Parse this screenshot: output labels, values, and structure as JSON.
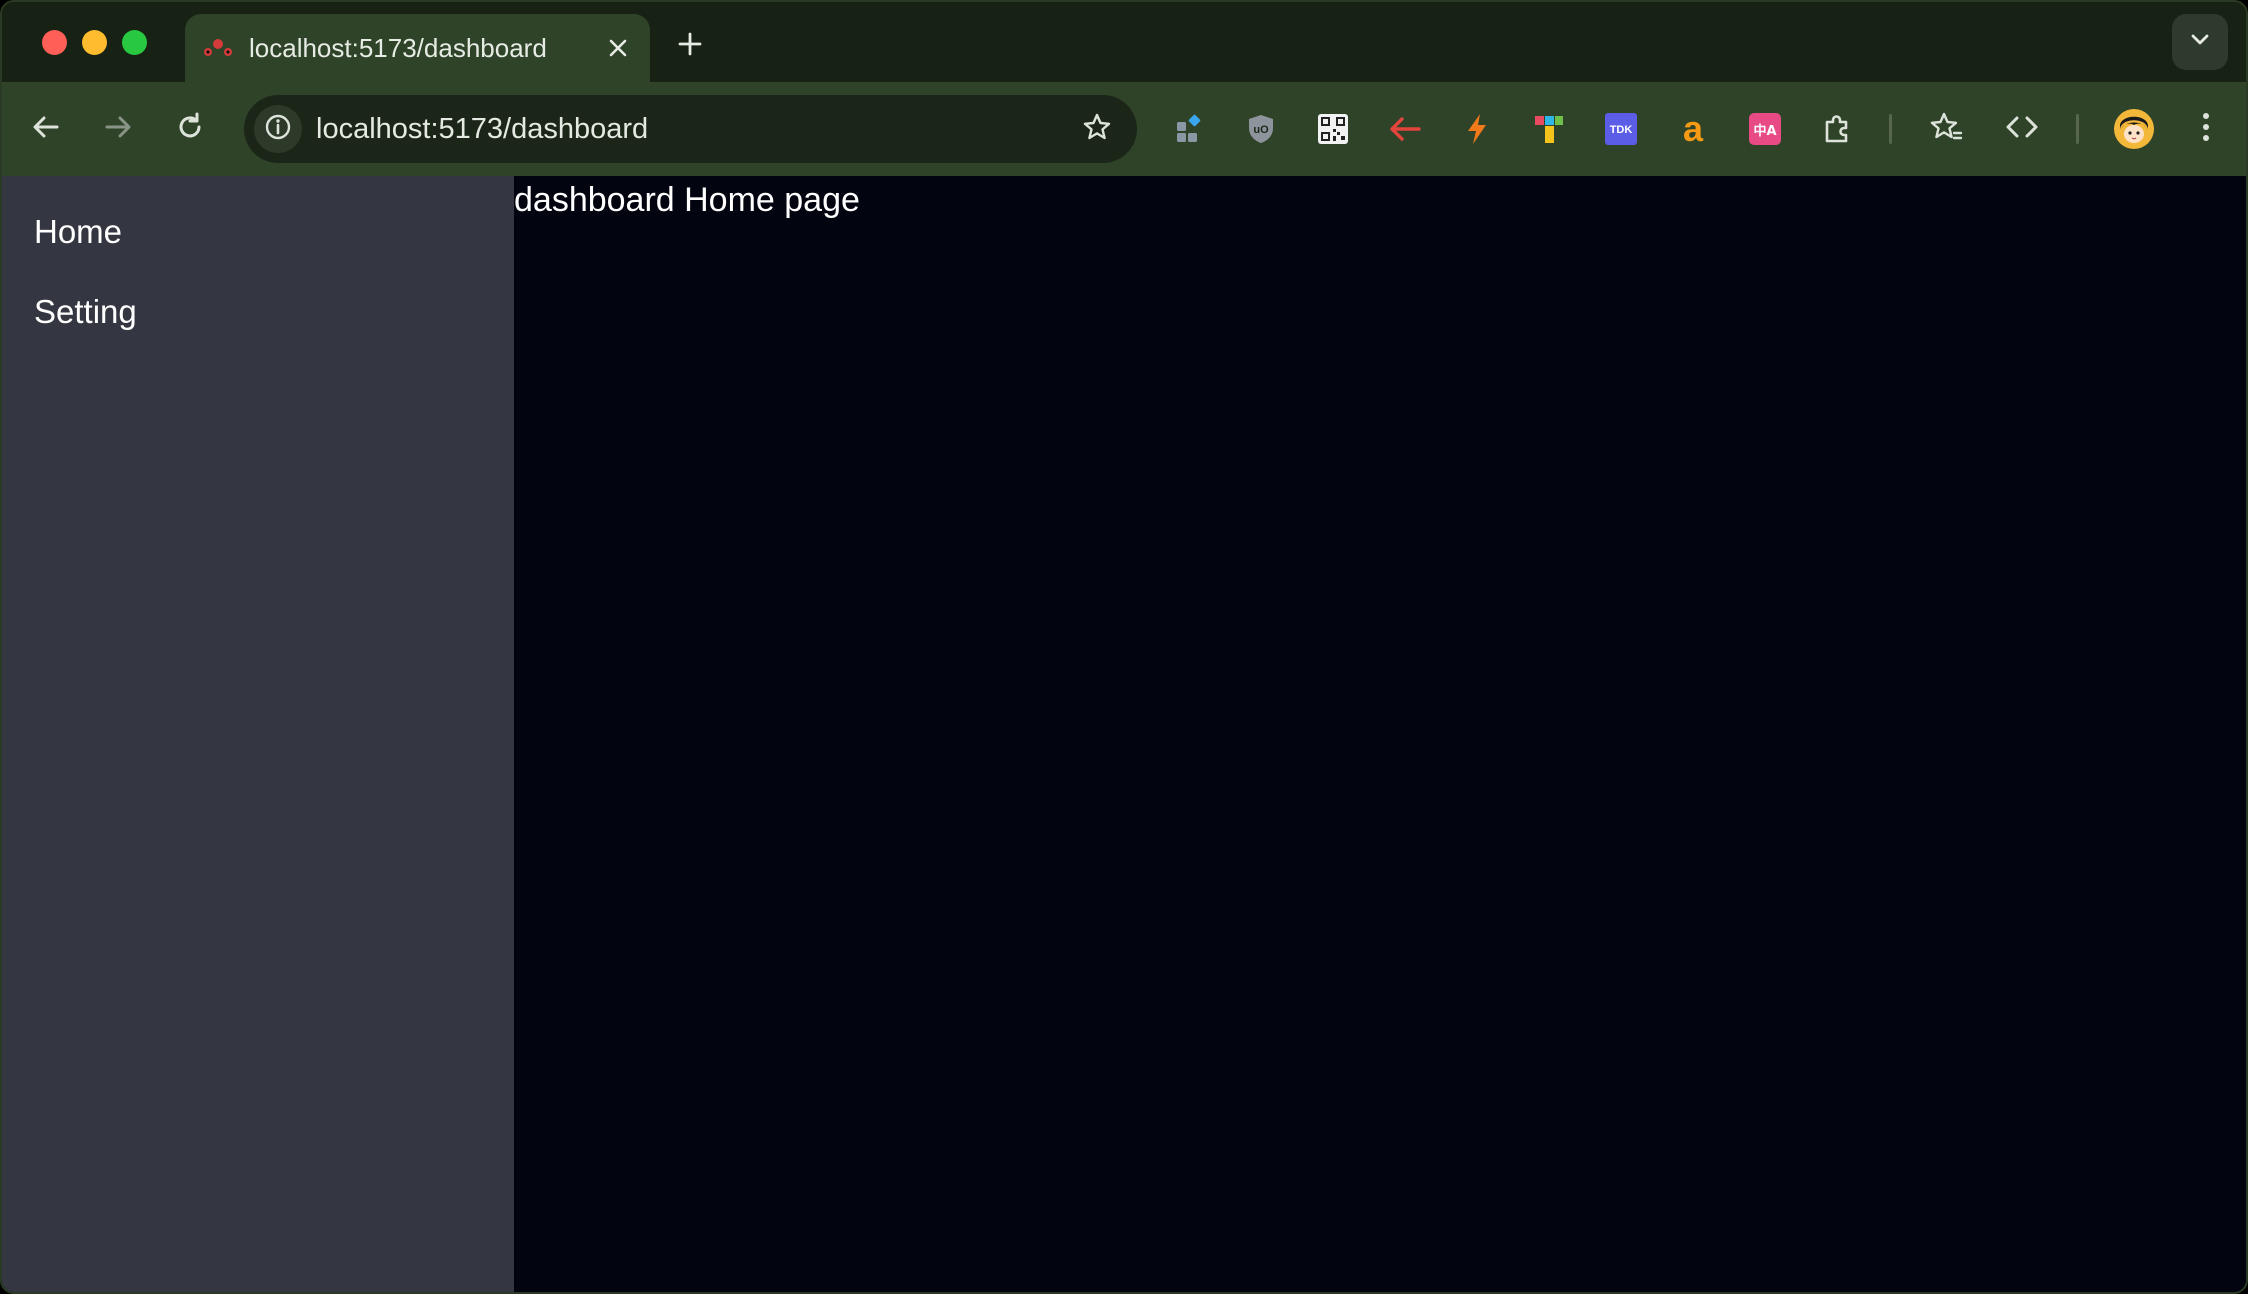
{
  "browser": {
    "tab": {
      "title": "localhost:5173/dashboard",
      "favicon": "react-router-icon"
    },
    "address_bar": {
      "url": "localhost:5173/dashboard"
    },
    "extensions": [
      {
        "name": "grid-app-icon"
      },
      {
        "name": "ublock-shield-icon",
        "label": "uO"
      },
      {
        "name": "qr-code-icon"
      },
      {
        "name": "red-arrow-left-icon"
      },
      {
        "name": "lightning-bolt-icon"
      },
      {
        "name": "color-tiles-icon"
      },
      {
        "name": "tdk-icon",
        "label": "TDK"
      },
      {
        "name": "letter-a-icon",
        "label": "a"
      },
      {
        "name": "translate-icon",
        "label": "中A"
      },
      {
        "name": "puzzle-piece-icon"
      }
    ],
    "colors": {
      "frame": "#172114",
      "toolbar": "#2f4329",
      "omnibox": "#1b2618"
    }
  },
  "sidebar": {
    "items": [
      {
        "label": "Home"
      },
      {
        "label": "Setting"
      }
    ],
    "background": "#343741"
  },
  "main": {
    "heading": "dashboard Home page",
    "background": "#02050f"
  }
}
